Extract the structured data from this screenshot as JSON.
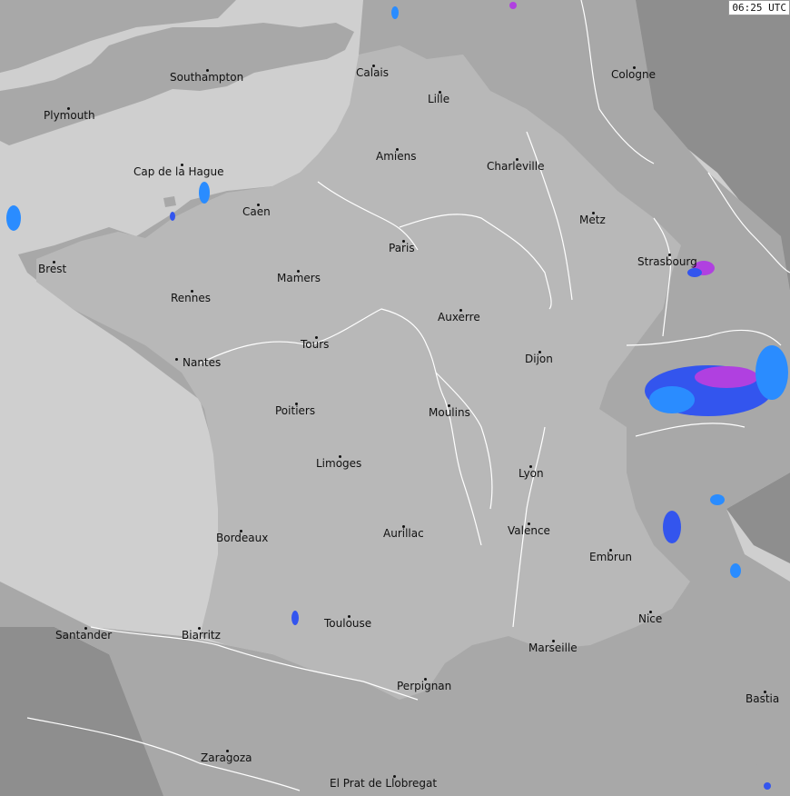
{
  "timestamp": "06:25 UTC",
  "cities": [
    {
      "id": "calais",
      "name": "Calais"
    },
    {
      "id": "southampton",
      "name": "Southampton"
    },
    {
      "id": "cologne",
      "name": "Cologne"
    },
    {
      "id": "lille",
      "name": "Lille"
    },
    {
      "id": "plymouth",
      "name": "Plymouth"
    },
    {
      "id": "amiens",
      "name": "Amiens"
    },
    {
      "id": "charleville",
      "name": "Charleville"
    },
    {
      "id": "cap-de-la-hague",
      "name": "Cap de la Hague"
    },
    {
      "id": "caen",
      "name": "Caen"
    },
    {
      "id": "metz",
      "name": "Metz"
    },
    {
      "id": "paris",
      "name": "Paris"
    },
    {
      "id": "brest",
      "name": "Brest"
    },
    {
      "id": "strasbourg",
      "name": "Strasbourg"
    },
    {
      "id": "mamers",
      "name": "Mamers"
    },
    {
      "id": "rennes",
      "name": "Rennes"
    },
    {
      "id": "auxerre",
      "name": "Auxerre"
    },
    {
      "id": "tours",
      "name": "Tours"
    },
    {
      "id": "nantes",
      "name": "Nantes"
    },
    {
      "id": "dijon",
      "name": "Dijon"
    },
    {
      "id": "poitiers",
      "name": "Poitiers"
    },
    {
      "id": "moulins",
      "name": "Moulins"
    },
    {
      "id": "limoges",
      "name": "Limoges"
    },
    {
      "id": "lyon",
      "name": "Lyon"
    },
    {
      "id": "valence",
      "name": "Valence"
    },
    {
      "id": "bordeaux",
      "name": "Bordeaux"
    },
    {
      "id": "aurillac",
      "name": "Aurillac"
    },
    {
      "id": "embrun",
      "name": "Embrun"
    },
    {
      "id": "nice",
      "name": "Nice"
    },
    {
      "id": "santander",
      "name": "Santander"
    },
    {
      "id": "biarritz",
      "name": "Biarritz"
    },
    {
      "id": "toulouse",
      "name": "Toulouse"
    },
    {
      "id": "marseille",
      "name": "Marseille"
    },
    {
      "id": "perpignan",
      "name": "Perpignan"
    },
    {
      "id": "bastia",
      "name": "Bastia"
    },
    {
      "id": "zaragoza",
      "name": "Zaragoza"
    },
    {
      "id": "el-prat",
      "name": "El Prat de Llobregat"
    }
  ],
  "colors": {
    "sea": "#cfcfcf",
    "land_in_coverage": "#a8a8a8",
    "land_outside_coverage": "#8c8c8c",
    "france": "#b8b8b8",
    "rivers_borders": "#ffffff",
    "precip_light": "#2a8cff",
    "precip_medium": "#3355ee",
    "precip_heavy": "#b040e0"
  }
}
